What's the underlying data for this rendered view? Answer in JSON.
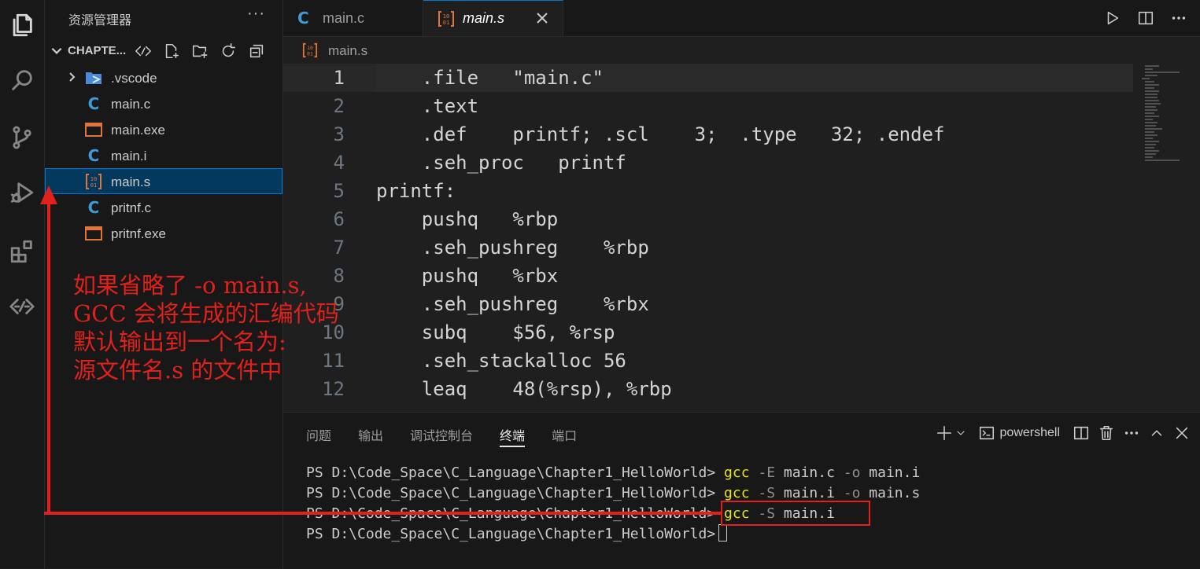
{
  "sidebar": {
    "title": "资源管理器",
    "more": "···",
    "folder_name": "CHAPTE...",
    "items": [
      {
        "label": ".vscode",
        "type": "folder"
      },
      {
        "label": "main.c",
        "type": "c"
      },
      {
        "label": "main.exe",
        "type": "exe"
      },
      {
        "label": "main.i",
        "type": "c"
      },
      {
        "label": "main.s",
        "type": "asm",
        "selected": true
      },
      {
        "label": "pritnf.c",
        "type": "c"
      },
      {
        "label": "pritnf.exe",
        "type": "exe"
      }
    ]
  },
  "annotation": {
    "lines": [
      "如果省略了 -o main.s,",
      "GCC 会将生成的汇编代码",
      "默认输出到一个名为:",
      "源文件名.s 的文件中"
    ]
  },
  "tabs": [
    {
      "label": "main.c",
      "active": false
    },
    {
      "label": "main.s",
      "active": true
    }
  ],
  "breadcrumb": {
    "file": "main.s"
  },
  "code": {
    "lines": [
      {
        "num": "1",
        "text": "    .file   \"main.c\""
      },
      {
        "num": "2",
        "text": "    .text"
      },
      {
        "num": "3",
        "text": "    .def    printf; .scl    3;  .type   32; .endef"
      },
      {
        "num": "4",
        "text": "    .seh_proc   printf"
      },
      {
        "num": "5",
        "text": "printf:"
      },
      {
        "num": "6",
        "text": "    pushq   %rbp"
      },
      {
        "num": "7",
        "text": "    .seh_pushreg    %rbp"
      },
      {
        "num": "8",
        "text": "    pushq   %rbx"
      },
      {
        "num": "9",
        "text": "    .seh_pushreg    %rbx"
      },
      {
        "num": "10",
        "text": "    subq    $56, %rsp"
      },
      {
        "num": "11",
        "text": "    .seh_stackalloc 56"
      },
      {
        "num": "12",
        "text": "    leaq    48(%rsp), %rbp"
      }
    ]
  },
  "panel": {
    "tabs": [
      "问题",
      "输出",
      "调试控制台",
      "终端",
      "端口"
    ],
    "active_tab": "终端",
    "shell_label": "powershell"
  },
  "terminal": {
    "lines": [
      {
        "prompt": "PS D:\\Code_Space\\C_Language\\Chapter1_HelloWorld> ",
        "cmd": "gcc",
        "rest": [
          {
            "t": " ",
            "c": ""
          },
          {
            "t": "-E",
            "c": "flag"
          },
          {
            "t": " main.c ",
            "c": ""
          },
          {
            "t": "-o",
            "c": "flag"
          },
          {
            "t": " main.i",
            "c": ""
          }
        ]
      },
      {
        "prompt": "PS D:\\Code_Space\\C_Language\\Chapter1_HelloWorld> ",
        "cmd": "gcc",
        "rest": [
          {
            "t": " ",
            "c": ""
          },
          {
            "t": "-S",
            "c": "flag"
          },
          {
            "t": " main.i ",
            "c": ""
          },
          {
            "t": "-o",
            "c": "flag"
          },
          {
            "t": " main.s",
            "c": ""
          }
        ]
      },
      {
        "prompt": "PS D:\\Code_Space\\C_Language\\Chapter1_HelloWorld> ",
        "cmd": "gcc",
        "rest": [
          {
            "t": " ",
            "c": ""
          },
          {
            "t": "-S",
            "c": "flag"
          },
          {
            "t": " main.i",
            "c": ""
          }
        ]
      },
      {
        "prompt": "PS D:\\Code_Space\\C_Language\\Chapter1_HelloWorld>",
        "cmd": "",
        "rest": [],
        "cursor": true
      }
    ]
  },
  "colors": {
    "accent": "#0078d4",
    "annotation_red": "#e0211c",
    "command_yellow": "#e5e510",
    "c_icon_blue": "#3e9bd8",
    "asm_icon_orange": "#e2743a"
  }
}
